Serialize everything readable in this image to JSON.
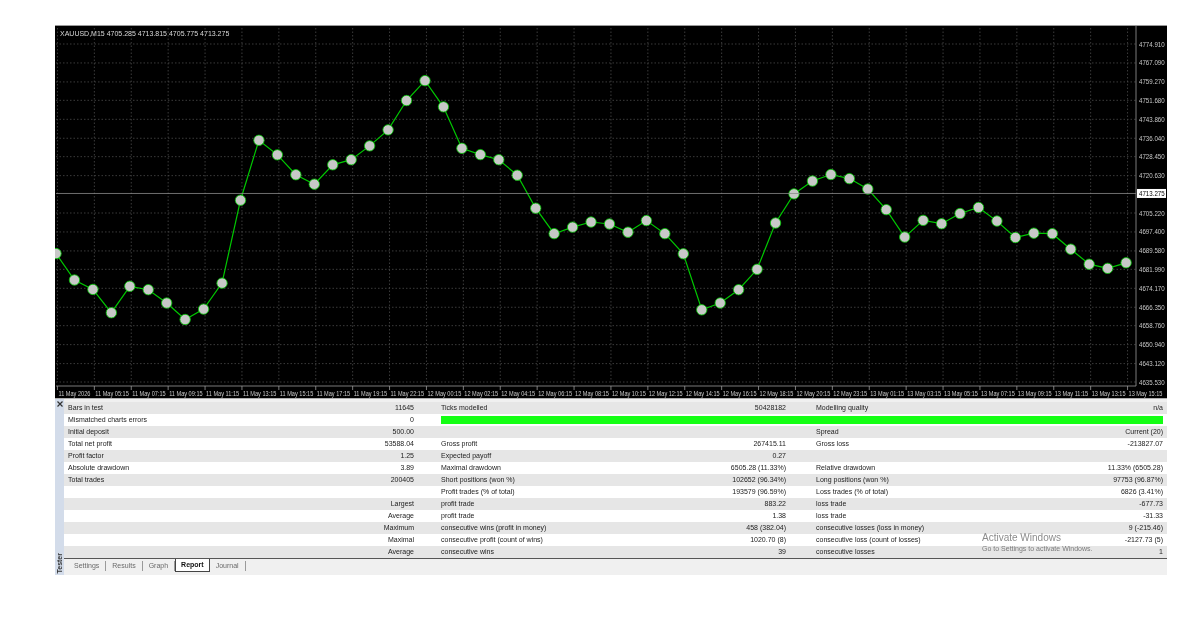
{
  "chart": {
    "chart_data": {
      "type": "line",
      "title": "XAUUSD,M15  4705.285 4713.815 4705.775 4713.275",
      "categories": [
        null,
        "11 May 2026",
        null,
        "11 May 05:15",
        null,
        "11 May 07:15",
        null,
        "11 May 09:15",
        null,
        "11 May 11:15",
        null,
        "11 May 13:15",
        null,
        "11 May 15:15",
        null,
        "11 May 17:15",
        null,
        "11 May 19:15",
        null,
        "11 May 22:15",
        null,
        "12 May 00:15",
        null,
        "12 May 02:15",
        null,
        "12 May 04:15",
        null,
        "12 May 06:15",
        null,
        "12 May 08:15",
        null,
        "12 May 10:15",
        null,
        "12 May 12:15",
        null,
        "12 May 14:15",
        null,
        "12 May 16:15",
        null,
        "12 May 18:15",
        null,
        "12 May 20:15",
        null,
        "12 May 23:15",
        null,
        "13 May 01:15",
        null,
        "13 May 03:15",
        null,
        "13 May 05:15",
        null,
        "13 May 07:15",
        null,
        "13 May 09:15",
        null,
        "13 May 11:15",
        null,
        "13 May 13:15",
        null,
        "13 May 15:15"
      ],
      "series": [
        {
          "color": "#00c800",
          "marker": "circle",
          "values": [
            4688.5,
            4677.6,
            4673.7,
            4664.1,
            4675.0,
            4673.6,
            4668.1,
            4661.3,
            4665.6,
            4676.3,
            4710.5,
            4735.2,
            4729.2,
            4721.0,
            4717.1,
            4725.1,
            4727.2,
            4732.9,
            4739.5,
            4751.6,
            4759.8,
            4749.0,
            4731.9,
            4729.3,
            4727.2,
            4720.8,
            4707.2,
            4696.7,
            4699.4,
            4701.5,
            4700.7,
            4697.3,
            4702.1,
            4696.7,
            4688.4,
            4665.3,
            4668.1,
            4673.6,
            4682.0,
            4701.1,
            4713.1,
            4718.4,
            4721.1,
            4719.4,
            4715.1,
            4706.6,
            4695.3,
            4702.2,
            4700.8,
            4705.0,
            4707.5,
            4701.9,
            4695.1,
            4696.9,
            4696.7,
            4690.3,
            4684.1,
            4682.4,
            4684.7,
            null
          ]
        }
      ],
      "ylim": [
        4635.53,
        4781.51
      ],
      "yticks": [
        {
          "value": 4774.91,
          "label": "4774.910"
        },
        {
          "value": 4767.09,
          "label": "4767.090"
        },
        {
          "value": 4759.27,
          "label": "4759.270"
        },
        {
          "value": 4751.68,
          "label": "4751.680"
        },
        {
          "value": 4743.86,
          "label": "4743.860"
        },
        {
          "value": 4736.04,
          "label": "4736.040"
        },
        {
          "value": 4728.45,
          "label": "4728.450"
        },
        {
          "value": 4720.63,
          "label": "4720.630"
        },
        {
          "value": 4705.22,
          "label": "4705.220"
        },
        {
          "value": 4697.4,
          "label": "4697.400"
        },
        {
          "value": 4689.58,
          "label": "4689.580"
        },
        {
          "value": 4681.99,
          "label": "4681.990"
        },
        {
          "value": 4674.17,
          "label": "4674.170"
        },
        {
          "value": 4666.35,
          "label": "4666.350"
        },
        {
          "value": 4658.76,
          "label": "4658.760"
        },
        {
          "value": 4650.94,
          "label": "4650.940"
        },
        {
          "value": 4643.12,
          "label": "4643.120"
        },
        {
          "value": 4635.53,
          "label": "4635.530"
        }
      ],
      "grid": true,
      "ref_lines": [
        {
          "axis": "y",
          "value": 4713.275,
          "label": "4713.275"
        }
      ]
    }
  },
  "tester": {
    "title": "Tester",
    "rows": [
      {
        "left": {
          "label": "Bars in test",
          "value": "11645"
        },
        "middle": {
          "label": "Ticks modelled",
          "value": "50428182"
        },
        "right": {
          "label": "Modelling quality",
          "value": "n/a"
        }
      },
      {
        "left": {
          "label": "Mismatched charts errors",
          "value": "0"
        },
        "quality_bar": {
          "level": 1
        }
      },
      {
        "left": {
          "label": "Initial deposit",
          "value": "500.00"
        },
        "right": {
          "label": "Spread",
          "value": "Current (20)"
        }
      },
      {
        "left": {
          "label": "Total net profit",
          "value": "53588.04"
        },
        "middle": {
          "label": "Gross profit",
          "value": "267415.11"
        },
        "right": {
          "label": "Gross loss",
          "value": "-213827.07"
        }
      },
      {
        "left": {
          "label": "Profit factor",
          "value": "1.25"
        },
        "middle": {
          "label": "Expected payoff",
          "value": "0.27"
        }
      },
      {
        "left": {
          "label": "Absolute drawdown",
          "value": "3.89"
        },
        "middle": {
          "label": "Maximal drawdown",
          "value": "6505.28 (11.33%)"
        },
        "right": {
          "label": "Relative drawdown",
          "value": "11.33% (6505.28)"
        }
      },
      {
        "left": {
          "label": "Total trades",
          "value": "200405"
        },
        "middle": {
          "label": "Short positions (won %)",
          "value": "102652 (96.34%)"
        },
        "right": {
          "label": "Long positions (won %)",
          "value": "97753 (96.87%)"
        }
      },
      {
        "middle": {
          "label": "Profit trades (% of total)",
          "value": "193579 (96.59%)"
        },
        "right": {
          "label": "Loss trades (% of total)",
          "value": "6826 (3.41%)"
        }
      },
      {
        "qualifier": "Largest",
        "middle": {
          "label": "profit trade",
          "value": "883.22"
        },
        "right": {
          "label": "loss trade",
          "value": "-677.73"
        }
      },
      {
        "qualifier": "Average",
        "middle": {
          "label": "profit trade",
          "value": "1.38"
        },
        "right": {
          "label": "loss trade",
          "value": "-31.33"
        }
      },
      {
        "qualifier": "Maximum",
        "middle": {
          "label": "consecutive wins (profit in money)",
          "value": "458 (382.04)"
        },
        "right": {
          "label": "consecutive losses (loss in money)",
          "value": "9 (-215.46)"
        }
      },
      {
        "qualifier": "Maximal",
        "middle": {
          "label": "consecutive profit (count of wins)",
          "value": "1020.70 (8)"
        },
        "right": {
          "label": "consecutive loss (count of losses)",
          "value": "-2127.73 (5)"
        }
      },
      {
        "qualifier": "Average",
        "middle": {
          "label": "consecutive wins",
          "value": "39"
        },
        "right": {
          "label": "consecutive losses",
          "value": "1"
        }
      }
    ],
    "tabs": [
      {
        "label": "Settings",
        "selected": false
      },
      {
        "label": "Results",
        "selected": false
      },
      {
        "label": "Graph",
        "selected": false
      },
      {
        "label": "Report",
        "selected": true
      },
      {
        "label": "Journal",
        "selected": false
      }
    ]
  },
  "os_overlay": {
    "title": "Activate Windows",
    "text": "Go to Settings to activate Windows."
  }
}
